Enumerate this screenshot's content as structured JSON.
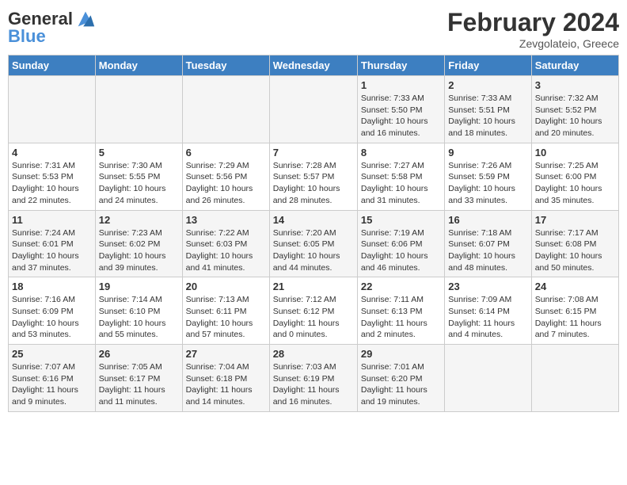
{
  "header": {
    "logo_line1": "General",
    "logo_line2": "Blue",
    "month": "February 2024",
    "location": "Zevgolateio, Greece"
  },
  "weekdays": [
    "Sunday",
    "Monday",
    "Tuesday",
    "Wednesday",
    "Thursday",
    "Friday",
    "Saturday"
  ],
  "weeks": [
    [
      {
        "day": "",
        "info": ""
      },
      {
        "day": "",
        "info": ""
      },
      {
        "day": "",
        "info": ""
      },
      {
        "day": "",
        "info": ""
      },
      {
        "day": "1",
        "info": "Sunrise: 7:33 AM\nSunset: 5:50 PM\nDaylight: 10 hours\nand 16 minutes."
      },
      {
        "day": "2",
        "info": "Sunrise: 7:33 AM\nSunset: 5:51 PM\nDaylight: 10 hours\nand 18 minutes."
      },
      {
        "day": "3",
        "info": "Sunrise: 7:32 AM\nSunset: 5:52 PM\nDaylight: 10 hours\nand 20 minutes."
      }
    ],
    [
      {
        "day": "4",
        "info": "Sunrise: 7:31 AM\nSunset: 5:53 PM\nDaylight: 10 hours\nand 22 minutes."
      },
      {
        "day": "5",
        "info": "Sunrise: 7:30 AM\nSunset: 5:55 PM\nDaylight: 10 hours\nand 24 minutes."
      },
      {
        "day": "6",
        "info": "Sunrise: 7:29 AM\nSunset: 5:56 PM\nDaylight: 10 hours\nand 26 minutes."
      },
      {
        "day": "7",
        "info": "Sunrise: 7:28 AM\nSunset: 5:57 PM\nDaylight: 10 hours\nand 28 minutes."
      },
      {
        "day": "8",
        "info": "Sunrise: 7:27 AM\nSunset: 5:58 PM\nDaylight: 10 hours\nand 31 minutes."
      },
      {
        "day": "9",
        "info": "Sunrise: 7:26 AM\nSunset: 5:59 PM\nDaylight: 10 hours\nand 33 minutes."
      },
      {
        "day": "10",
        "info": "Sunrise: 7:25 AM\nSunset: 6:00 PM\nDaylight: 10 hours\nand 35 minutes."
      }
    ],
    [
      {
        "day": "11",
        "info": "Sunrise: 7:24 AM\nSunset: 6:01 PM\nDaylight: 10 hours\nand 37 minutes."
      },
      {
        "day": "12",
        "info": "Sunrise: 7:23 AM\nSunset: 6:02 PM\nDaylight: 10 hours\nand 39 minutes."
      },
      {
        "day": "13",
        "info": "Sunrise: 7:22 AM\nSunset: 6:03 PM\nDaylight: 10 hours\nand 41 minutes."
      },
      {
        "day": "14",
        "info": "Sunrise: 7:20 AM\nSunset: 6:05 PM\nDaylight: 10 hours\nand 44 minutes."
      },
      {
        "day": "15",
        "info": "Sunrise: 7:19 AM\nSunset: 6:06 PM\nDaylight: 10 hours\nand 46 minutes."
      },
      {
        "day": "16",
        "info": "Sunrise: 7:18 AM\nSunset: 6:07 PM\nDaylight: 10 hours\nand 48 minutes."
      },
      {
        "day": "17",
        "info": "Sunrise: 7:17 AM\nSunset: 6:08 PM\nDaylight: 10 hours\nand 50 minutes."
      }
    ],
    [
      {
        "day": "18",
        "info": "Sunrise: 7:16 AM\nSunset: 6:09 PM\nDaylight: 10 hours\nand 53 minutes."
      },
      {
        "day": "19",
        "info": "Sunrise: 7:14 AM\nSunset: 6:10 PM\nDaylight: 10 hours\nand 55 minutes."
      },
      {
        "day": "20",
        "info": "Sunrise: 7:13 AM\nSunset: 6:11 PM\nDaylight: 10 hours\nand 57 minutes."
      },
      {
        "day": "21",
        "info": "Sunrise: 7:12 AM\nSunset: 6:12 PM\nDaylight: 11 hours\nand 0 minutes."
      },
      {
        "day": "22",
        "info": "Sunrise: 7:11 AM\nSunset: 6:13 PM\nDaylight: 11 hours\nand 2 minutes."
      },
      {
        "day": "23",
        "info": "Sunrise: 7:09 AM\nSunset: 6:14 PM\nDaylight: 11 hours\nand 4 minutes."
      },
      {
        "day": "24",
        "info": "Sunrise: 7:08 AM\nSunset: 6:15 PM\nDaylight: 11 hours\nand 7 minutes."
      }
    ],
    [
      {
        "day": "25",
        "info": "Sunrise: 7:07 AM\nSunset: 6:16 PM\nDaylight: 11 hours\nand 9 minutes."
      },
      {
        "day": "26",
        "info": "Sunrise: 7:05 AM\nSunset: 6:17 PM\nDaylight: 11 hours\nand 11 minutes."
      },
      {
        "day": "27",
        "info": "Sunrise: 7:04 AM\nSunset: 6:18 PM\nDaylight: 11 hours\nand 14 minutes."
      },
      {
        "day": "28",
        "info": "Sunrise: 7:03 AM\nSunset: 6:19 PM\nDaylight: 11 hours\nand 16 minutes."
      },
      {
        "day": "29",
        "info": "Sunrise: 7:01 AM\nSunset: 6:20 PM\nDaylight: 11 hours\nand 19 minutes."
      },
      {
        "day": "",
        "info": ""
      },
      {
        "day": "",
        "info": ""
      }
    ]
  ]
}
